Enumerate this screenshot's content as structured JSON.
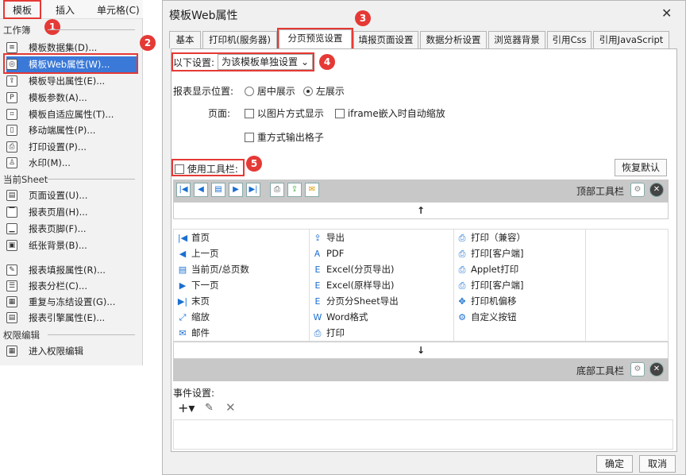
{
  "menu": {
    "tabs": [
      "模板",
      "插入",
      "单元格(C)"
    ]
  },
  "sections": {
    "workbook": "工作簿",
    "sheet": "当前Sheet",
    "perm": "权限编辑"
  },
  "items": [
    {
      "label": "模板数据集(D)...",
      "icon": "database-icon"
    },
    {
      "label": "模板Web属性(W)...",
      "icon": "globe-icon"
    },
    {
      "label": "模板导出属性(E)...",
      "icon": "export-icon"
    },
    {
      "label": "模板参数(A)...",
      "icon": "parameter-icon"
    },
    {
      "label": "模板自适应属性(T)...",
      "icon": "adaptive-icon"
    },
    {
      "label": "移动端属性(P)...",
      "icon": "mobile-icon"
    },
    {
      "label": "打印设置(P)...",
      "icon": "printer-icon"
    },
    {
      "label": "水印(M)...",
      "icon": "watermark-icon"
    },
    {
      "label": "页面设置(U)...",
      "icon": "page-setup-icon"
    },
    {
      "label": "报表页眉(H)...",
      "icon": "header-icon"
    },
    {
      "label": "报表页脚(F)...",
      "icon": "footer-icon"
    },
    {
      "label": "纸张背景(B)...",
      "icon": "image-icon"
    },
    {
      "label": "报表填报属性(R)...",
      "icon": "fill-icon"
    },
    {
      "label": "报表分栏(C)...",
      "icon": "columns-icon"
    },
    {
      "label": "重复与冻结设置(G)...",
      "icon": "freeze-icon"
    },
    {
      "label": "报表引擎属性(E)...",
      "icon": "engine-icon"
    },
    {
      "label": "进入权限编辑",
      "icon": "permission-icon"
    }
  ],
  "badges": [
    "1",
    "2",
    "3",
    "4",
    "5"
  ],
  "dialog": {
    "title": "模板Web属性",
    "tabs": [
      "基本",
      "打印机(服务器)",
      "分页预览设置",
      "填报页面设置",
      "数据分析设置",
      "浏览器背景",
      "引用Css",
      "引用JavaScript"
    ],
    "settings_label": "以下设置:",
    "settings_value": "为该模板单独设置",
    "position_label": "报表显示位置:",
    "position_options": [
      "居中展示",
      "左展示"
    ],
    "page_label": "页面:",
    "page_opts": [
      "以图片方式显示",
      "iframe嵌入时自动缩放",
      "重方式输出格子"
    ],
    "use_toolbar": "使用工具栏:",
    "restore": "恢复默认",
    "top_toolbar": "顶部工具栏",
    "bottom_toolbar": "底部工具栏",
    "col1": [
      "首页",
      "上一页",
      "当前页/总页数",
      "下一页",
      "末页",
      "缩放",
      "邮件"
    ],
    "col2": [
      "导出",
      "PDF",
      "Excel(分页导出)",
      "Excel(原样导出)",
      "分页分Sheet导出",
      "Word格式",
      "打印"
    ],
    "col3": [
      "打印（兼容）",
      "打印[客户端]",
      "Applet打印",
      "打印[客户端]",
      "打印机偏移",
      "自定义按钮"
    ],
    "event_label": "事件设置:",
    "ok": "确定",
    "cancel": "取消"
  }
}
